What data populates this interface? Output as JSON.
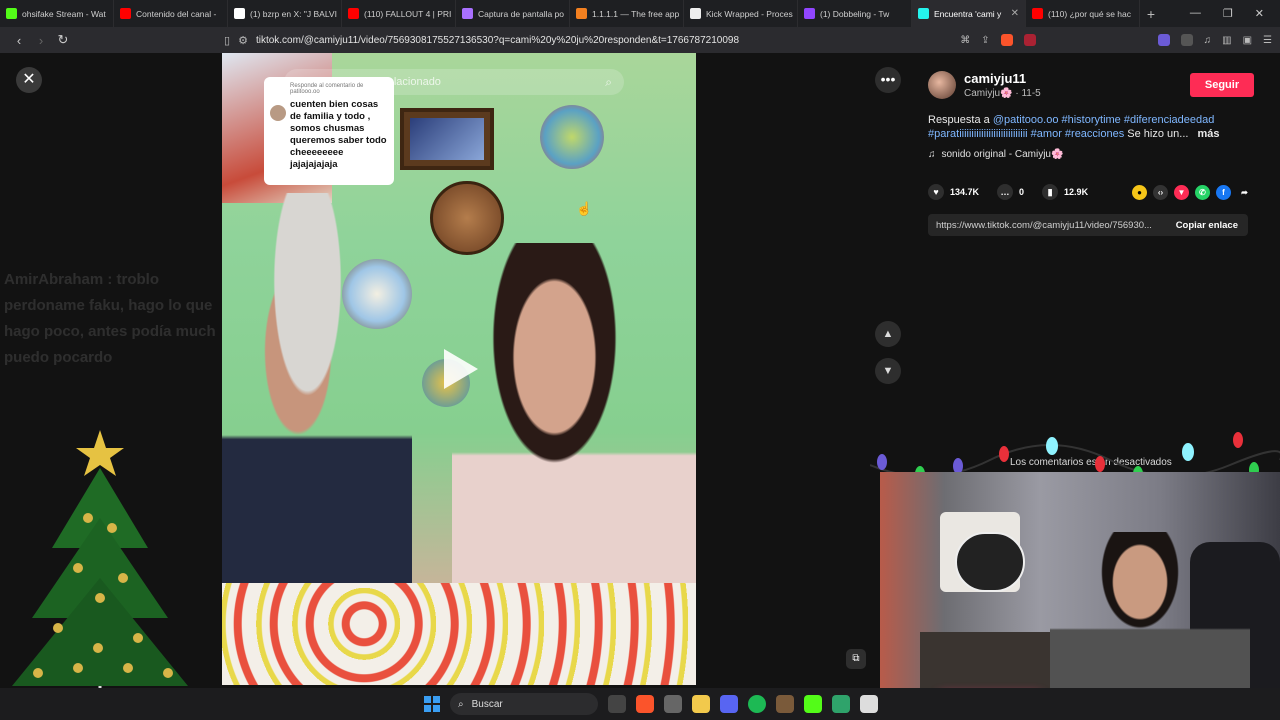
{
  "browser": {
    "tabs": [
      {
        "title": "ohsifake Stream - Wat",
        "color": "#53fc18"
      },
      {
        "title": "Contenido del canal -",
        "color": "#ff0000"
      },
      {
        "title": "(1) bzrp en X: \"J BALVI",
        "color": "#ffffff"
      },
      {
        "title": "(110) FALLOUT 4 | PRI",
        "color": "#ff0000"
      },
      {
        "title": "Captura de pantalla po",
        "color": "#a970ff"
      },
      {
        "title": "1.1.1.1 — The free app",
        "color": "#f38020"
      },
      {
        "title": "Kick Wrapped - Proces",
        "color": "#eeeeee"
      },
      {
        "title": "(1) Dobbeling - Tw",
        "color": "#9146ff"
      },
      {
        "title": "Encuentra 'cami y",
        "color": "#25f4ee",
        "active": true
      },
      {
        "title": "(110) ¿por qué se hac",
        "color": "#ff0000"
      }
    ],
    "new_tab": "+",
    "url": "tiktok.com/@camiyju11/video/7569308175527136530?q=cami%20y%20ju%20responden&t=1766787210098"
  },
  "video": {
    "search_placeholder": "Buscar contenido relacionado",
    "reply_header": "Responde al comentario de",
    "reply_user": "patitooo.oo",
    "reply_text": "cuenten bien cosas de familia y todo , somos chusmas queremos saber todo cheeeeeeee jajajajajaja"
  },
  "stream_chat": {
    "line1": "AmirAbraham : troblo",
    "line2": "perdoname faku, hago lo que",
    "line3": "hago poco, antes podía much",
    "line4": "puedo pocardo"
  },
  "sidebar": {
    "username": "camiyju11",
    "nickname": "Camiyju🌸",
    "date": "11-5",
    "follow_label": "Seguir",
    "desc_prefix": "Respuesta a ",
    "desc_mention": "@patitooo.oo",
    "desc_tags": "#historytime #diferenciadeedad #paratiiiiiiiiiiiiiiiiiiiiiiiiiiii #amor #reacciones",
    "desc_rest": "Se hizo un...",
    "more": "más",
    "music": "sonido original - Camiyju🌸",
    "likes": "134.7K",
    "comments": "0",
    "saves": "12.9K",
    "link": "https://www.tiktok.com/@camiyju11/video/756930...",
    "copy_label": "Copiar enlace",
    "comments_off": "Los comentarios están desactivados"
  },
  "taskbar": {
    "search_label": "Buscar"
  },
  "colors": {
    "follow": "#fe2c55",
    "link": "#7fb7ff"
  }
}
